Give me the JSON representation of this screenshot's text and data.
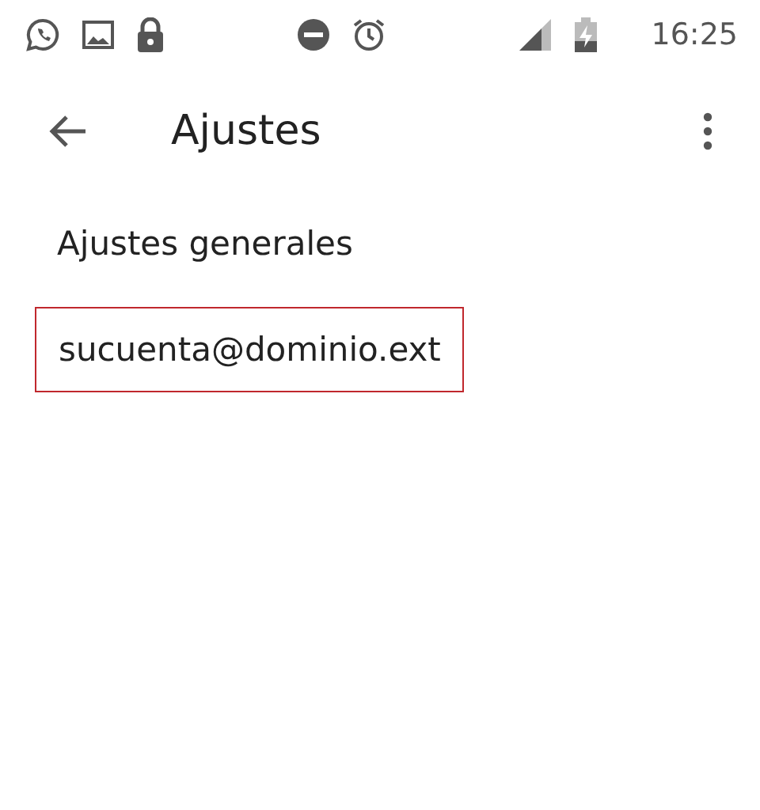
{
  "status_bar": {
    "time": "16:25"
  },
  "app_bar": {
    "title": "Ajustes"
  },
  "items": [
    {
      "label": "Ajustes generales",
      "highlighted": false
    },
    {
      "label": "sucuenta@dominio.ext",
      "highlighted": true
    }
  ]
}
